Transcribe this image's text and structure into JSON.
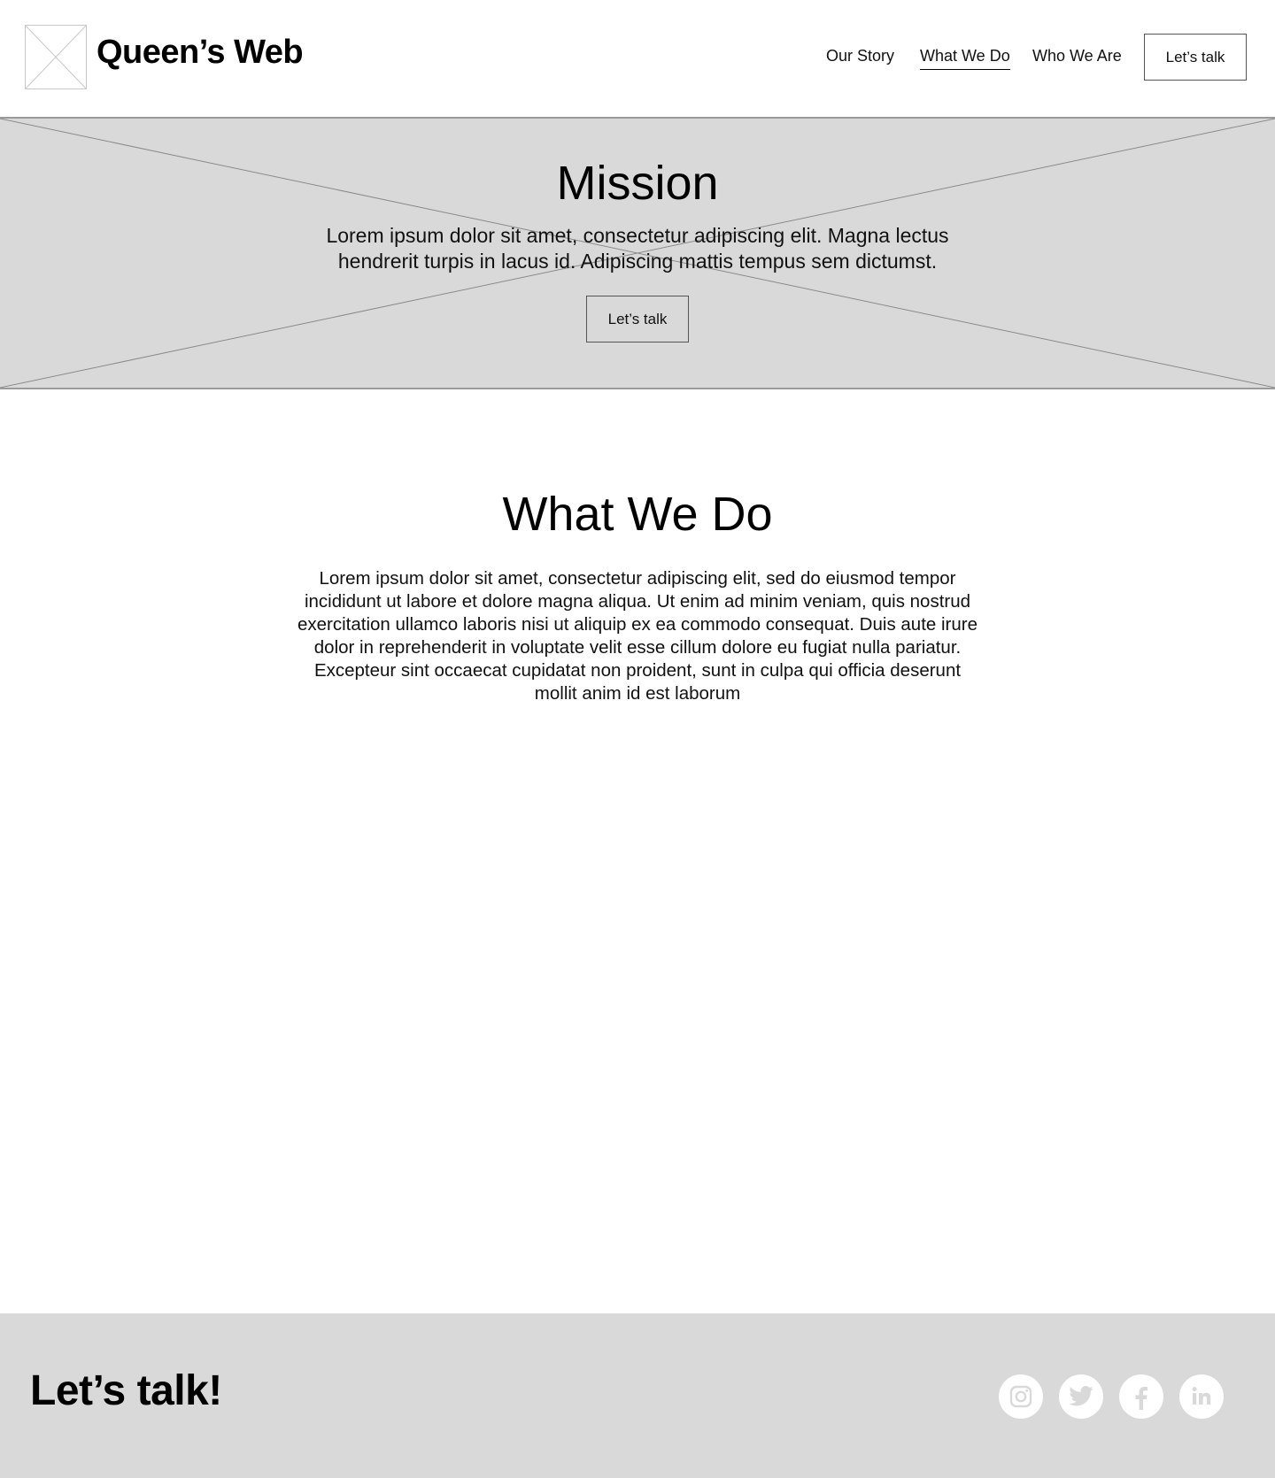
{
  "header": {
    "brand": "Queen’s Web",
    "nav": [
      {
        "label": "Our Story",
        "active": false
      },
      {
        "label": "What We Do",
        "active": true
      },
      {
        "label": "Who We Are",
        "active": false
      }
    ],
    "cta_label": "Let’s talk"
  },
  "hero": {
    "title": "Mission",
    "text": "Lorem ipsum dolor sit amet, consectetur adipiscing elit. Magna lectus hendrerit turpis in lacus id. Adipiscing mattis tempus sem dictumst.",
    "cta_label": "Let’s talk"
  },
  "what_we_do": {
    "title": "What We Do",
    "text": "Lorem ipsum dolor sit amet, consectetur adipiscing elit, sed do eiusmod tempor incididunt ut labore et dolore magna aliqua. Ut enim ad minim veniam, quis nostrud exercitation ullamco laboris nisi ut aliquip ex ea commodo consequat. Duis aute irure dolor in reprehenderit in voluptate velit esse cillum dolore eu fugiat nulla pariatur. Excepteur sint occaecat cupidatat non proident, sunt in culpa qui officia deserunt mollit anim id est laborum"
  },
  "footer": {
    "title": "Let’s talk!",
    "social_icons": [
      "instagram-icon",
      "twitter-icon",
      "facebook-icon",
      "linkedin-icon"
    ]
  },
  "colors": {
    "placeholder_gray": "#d9d9d9",
    "social_icon_gray": "#d9d9d9",
    "text": "#000000"
  }
}
